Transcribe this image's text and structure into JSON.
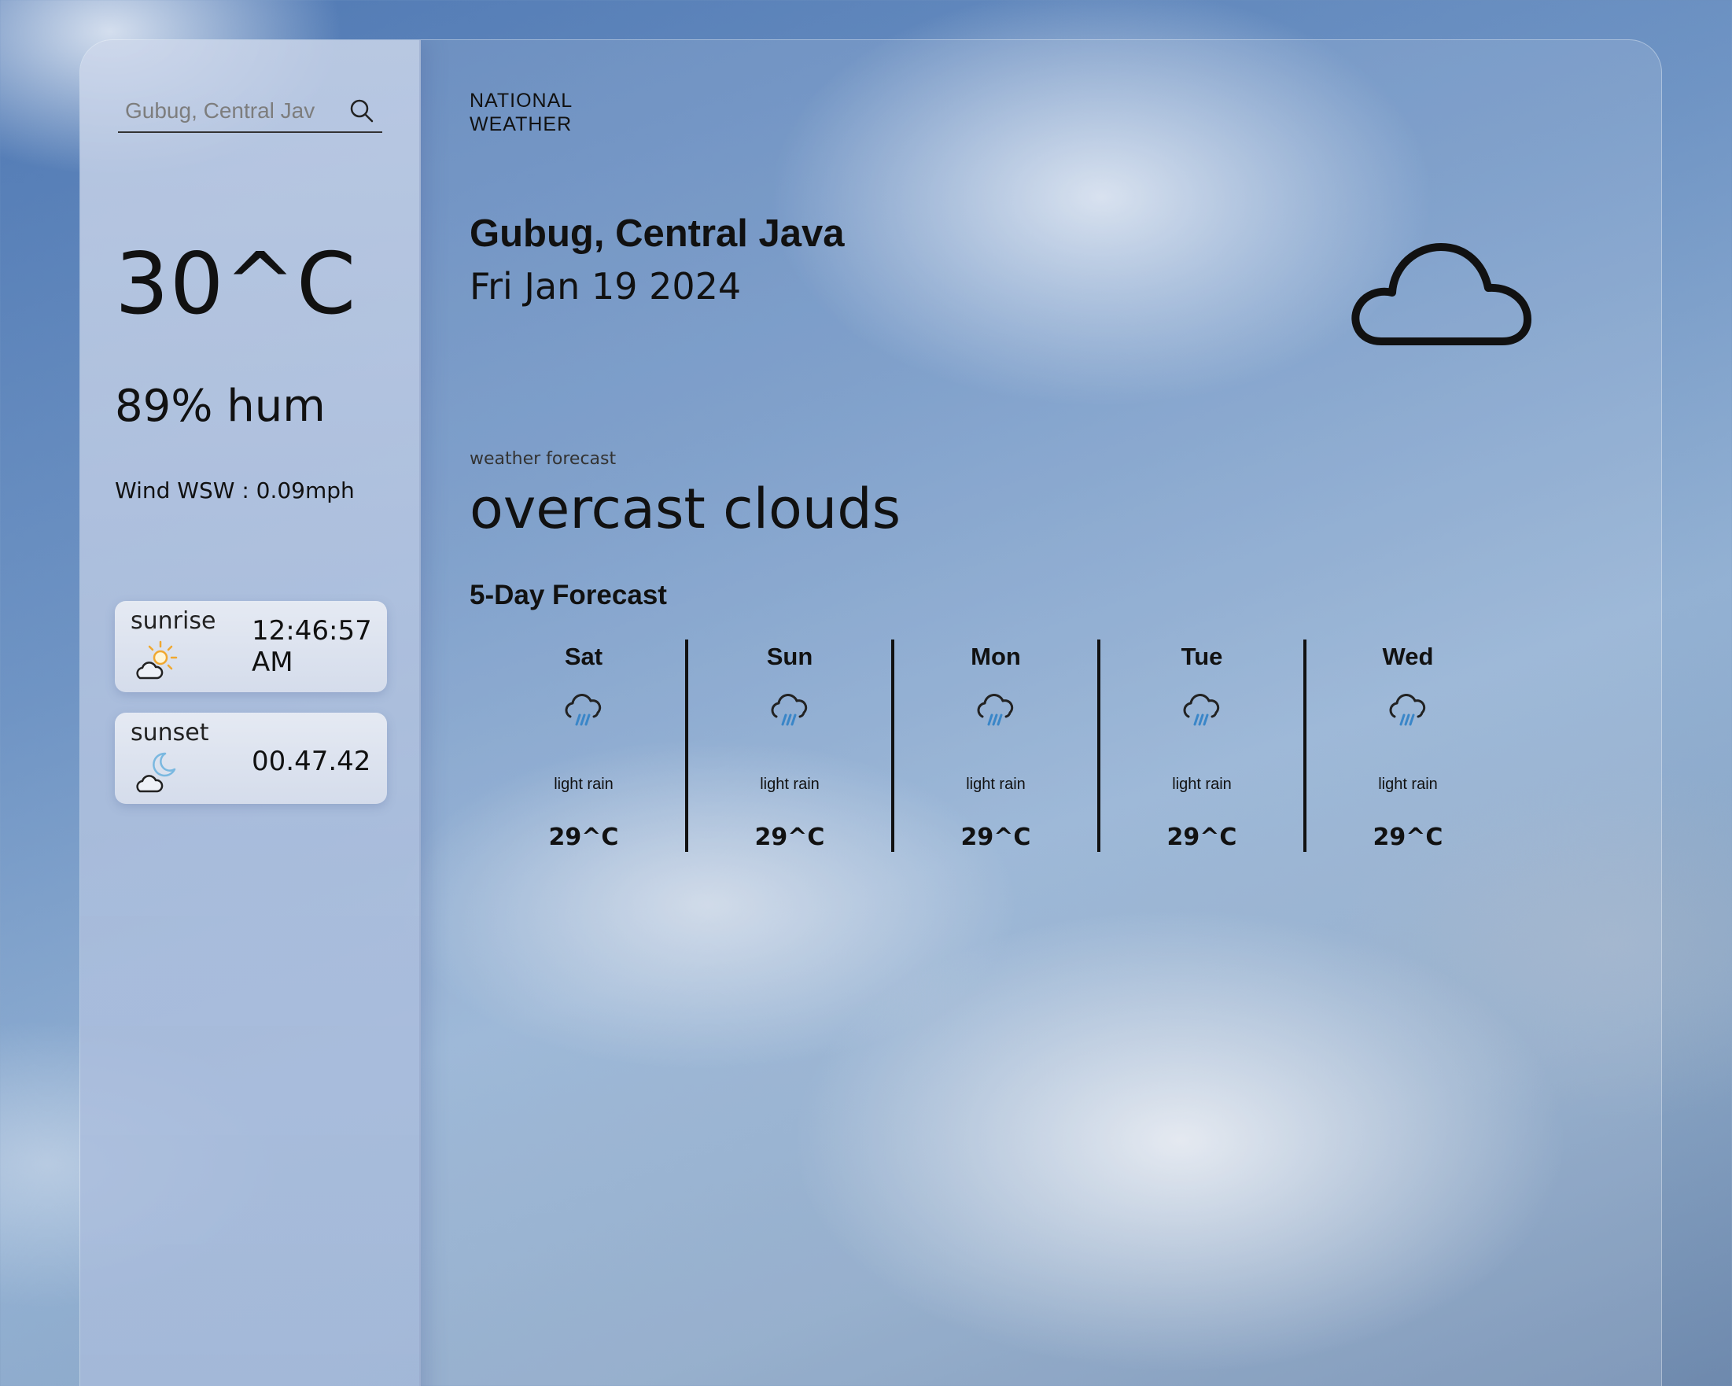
{
  "search": {
    "placeholder": "Gubug, Central Jav",
    "icon": "search-icon"
  },
  "current": {
    "temperature": "30^C",
    "humidity": "89% hum",
    "wind": "Wind WSW : 0.09mph"
  },
  "sunrise": {
    "label": "sunrise",
    "time": "12:46:57 AM",
    "icon": "sunrise-cloud-icon"
  },
  "sunset": {
    "label": "sunset",
    "time": "00.47.42",
    "icon": "moon-cloud-icon"
  },
  "header": {
    "brand": "NATIONAL WEATHER",
    "location": "Gubug, Central Java",
    "date": "Fri Jan 19 2024",
    "icon": "cloud-icon"
  },
  "forecast": {
    "label": "weather forecast",
    "description": "overcast clouds",
    "title": "5-Day Forecast",
    "days": [
      {
        "name": "Sat",
        "condition": "light rain",
        "temp": "29^C",
        "icon": "rain-cloud-icon"
      },
      {
        "name": "Sun",
        "condition": "light rain",
        "temp": "29^C",
        "icon": "rain-cloud-icon"
      },
      {
        "name": "Mon",
        "condition": "light rain",
        "temp": "29^C",
        "icon": "rain-cloud-icon"
      },
      {
        "name": "Tue",
        "condition": "light rain",
        "temp": "29^C",
        "icon": "rain-cloud-icon"
      },
      {
        "name": "Wed",
        "condition": "light rain",
        "temp": "29^C",
        "icon": "rain-cloud-icon"
      }
    ]
  },
  "colors": {
    "rain": "#3a86c8",
    "sun": "#f0a830",
    "moon": "#7ab8e0"
  }
}
